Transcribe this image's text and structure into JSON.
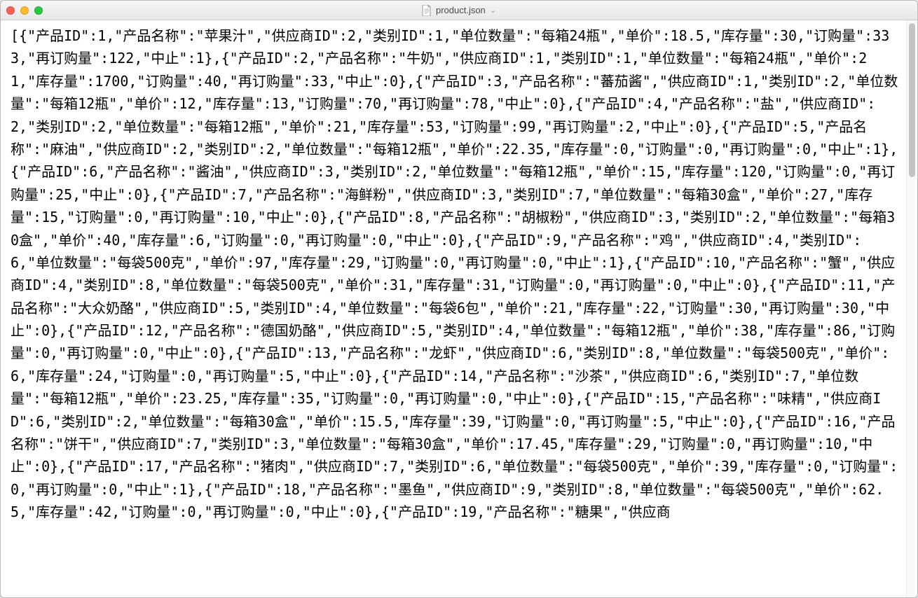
{
  "window": {
    "filename": "product.json",
    "dropdown_glyph": "⌄"
  },
  "traffic": {
    "close": "close",
    "minimize": "minimize",
    "zoom": "zoom"
  },
  "file_content": "[{\"产品ID\":1,\"产品名称\":\"苹果汁\",\"供应商ID\":2,\"类别ID\":1,\"单位数量\":\"每箱24瓶\",\"单价\":18.5,\"库存量\":30,\"订购量\":333,\"再订购量\":122,\"中止\":1},{\"产品ID\":2,\"产品名称\":\"牛奶\",\"供应商ID\":1,\"类别ID\":1,\"单位数量\":\"每箱24瓶\",\"单价\":21,\"库存量\":1700,\"订购量\":40,\"再订购量\":33,\"中止\":0},{\"产品ID\":3,\"产品名称\":\"蕃茄酱\",\"供应商ID\":1,\"类别ID\":2,\"单位数量\":\"每箱12瓶\",\"单价\":12,\"库存量\":13,\"订购量\":70,\"再订购量\":78,\"中止\":0},{\"产品ID\":4,\"产品名称\":\"盐\",\"供应商ID\":2,\"类别ID\":2,\"单位数量\":\"每箱12瓶\",\"单价\":21,\"库存量\":53,\"订购量\":99,\"再订购量\":2,\"中止\":0},{\"产品ID\":5,\"产品名称\":\"麻油\",\"供应商ID\":2,\"类别ID\":2,\"单位数量\":\"每箱12瓶\",\"单价\":22.35,\"库存量\":0,\"订购量\":0,\"再订购量\":0,\"中止\":1},{\"产品ID\":6,\"产品名称\":\"酱油\",\"供应商ID\":3,\"类别ID\":2,\"单位数量\":\"每箱12瓶\",\"单价\":15,\"库存量\":120,\"订购量\":0,\"再订购量\":25,\"中止\":0},{\"产品ID\":7,\"产品名称\":\"海鲜粉\",\"供应商ID\":3,\"类别ID\":7,\"单位数量\":\"每箱30盒\",\"单价\":27,\"库存量\":15,\"订购量\":0,\"再订购量\":10,\"中止\":0},{\"产品ID\":8,\"产品名称\":\"胡椒粉\",\"供应商ID\":3,\"类别ID\":2,\"单位数量\":\"每箱30盒\",\"单价\":40,\"库存量\":6,\"订购量\":0,\"再订购量\":0,\"中止\":0},{\"产品ID\":9,\"产品名称\":\"鸡\",\"供应商ID\":4,\"类别ID\":6,\"单位数量\":\"每袋500克\",\"单价\":97,\"库存量\":29,\"订购量\":0,\"再订购量\":0,\"中止\":1},{\"产品ID\":10,\"产品名称\":\"蟹\",\"供应商ID\":4,\"类别ID\":8,\"单位数量\":\"每袋500克\",\"单价\":31,\"库存量\":31,\"订购量\":0,\"再订购量\":0,\"中止\":0},{\"产品ID\":11,\"产品名称\":\"大众奶酪\",\"供应商ID\":5,\"类别ID\":4,\"单位数量\":\"每袋6包\",\"单价\":21,\"库存量\":22,\"订购量\":30,\"再订购量\":30,\"中止\":0},{\"产品ID\":12,\"产品名称\":\"德国奶酪\",\"供应商ID\":5,\"类别ID\":4,\"单位数量\":\"每箱12瓶\",\"单价\":38,\"库存量\":86,\"订购量\":0,\"再订购量\":0,\"中止\":0},{\"产品ID\":13,\"产品名称\":\"龙虾\",\"供应商ID\":6,\"类别ID\":8,\"单位数量\":\"每袋500克\",\"单价\":6,\"库存量\":24,\"订购量\":0,\"再订购量\":5,\"中止\":0},{\"产品ID\":14,\"产品名称\":\"沙茶\",\"供应商ID\":6,\"类别ID\":7,\"单位数量\":\"每箱12瓶\",\"单价\":23.25,\"库存量\":35,\"订购量\":0,\"再订购量\":0,\"中止\":0},{\"产品ID\":15,\"产品名称\":\"味精\",\"供应商ID\":6,\"类别ID\":2,\"单位数量\":\"每箱30盒\",\"单价\":15.5,\"库存量\":39,\"订购量\":0,\"再订购量\":5,\"中止\":0},{\"产品ID\":16,\"产品名称\":\"饼干\",\"供应商ID\":7,\"类别ID\":3,\"单位数量\":\"每箱30盒\",\"单价\":17.45,\"库存量\":29,\"订购量\":0,\"再订购量\":10,\"中止\":0},{\"产品ID\":17,\"产品名称\":\"猪肉\",\"供应商ID\":7,\"类别ID\":6,\"单位数量\":\"每袋500克\",\"单价\":39,\"库存量\":0,\"订购量\":0,\"再订购量\":0,\"中止\":1},{\"产品ID\":18,\"产品名称\":\"墨鱼\",\"供应商ID\":9,\"类别ID\":8,\"单位数量\":\"每袋500克\",\"单价\":62.5,\"库存量\":42,\"订购量\":0,\"再订购量\":0,\"中止\":0},{\"产品ID\":19,\"产品名称\":\"糖果\",\"供应商"
}
